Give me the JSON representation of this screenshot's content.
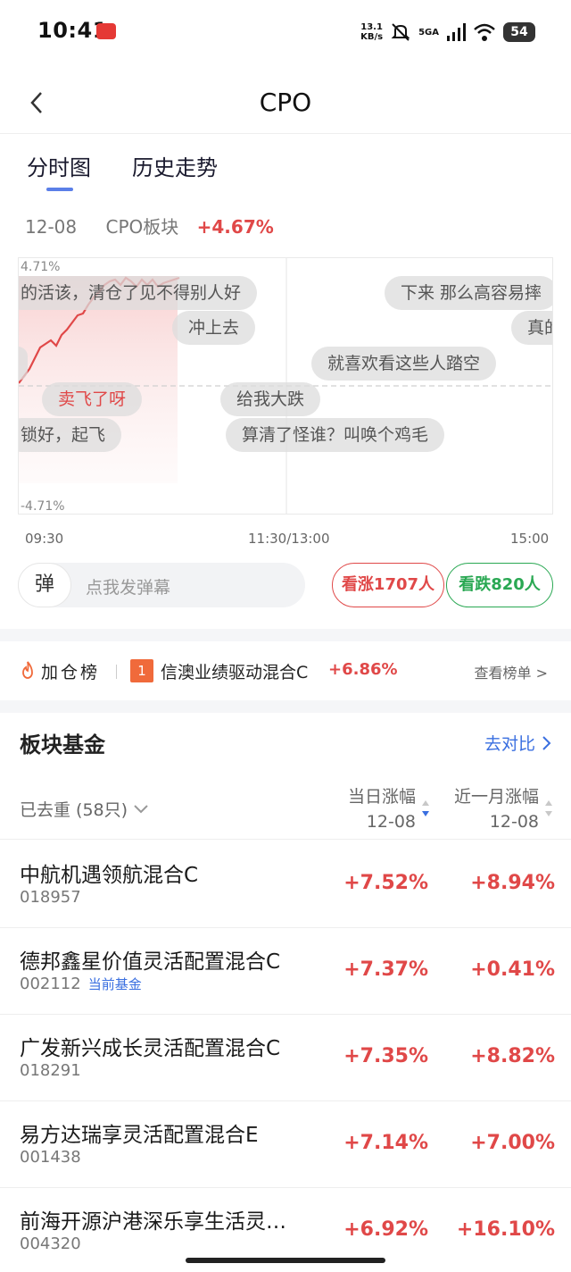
{
  "status_bar": {
    "time": "10:41",
    "net_speed_value": "13.1",
    "net_speed_unit": "KB/s",
    "network": "5GA",
    "battery": "54"
  },
  "nav": {
    "title": "CPO"
  },
  "tabs": [
    {
      "label": "分时图",
      "active": true
    },
    {
      "label": "历史走势",
      "active": false
    }
  ],
  "summary": {
    "date": "12-08",
    "sector": "CPO板块",
    "change": "+4.67%"
  },
  "chart": {
    "y_top": "4.71%",
    "y_bottom": "-4.71%",
    "x_labels": [
      "09:30",
      "11:30/13:00",
      "15:00"
    ],
    "danmu": [
      "的活该，清仓了见不得别人好",
      "下来 那么高容易摔",
      "冲上去",
      "真的",
      "就喜欢看这些人踏空",
      "卖飞了呀",
      "给我大跌",
      "锁好，起飞",
      "算清了怪谁？叫唤个鸡毛"
    ]
  },
  "danmu_bar": {
    "button": "弹",
    "placeholder": "点我发弹幕",
    "bullish": "看涨1707人",
    "bearish": "看跌820人"
  },
  "rank": {
    "title": "加仓榜",
    "rank_no": "1",
    "fund": "信澳业绩驱动混合C",
    "change": "+6.86%",
    "link": "查看榜单 >"
  },
  "section": {
    "title": "板块基金",
    "compare": "去对比"
  },
  "list_header": {
    "filter": "已去重 (58只)",
    "col_day_title": "当日涨幅",
    "col_day_date": "12-08",
    "col_month_title": "近一月涨幅",
    "col_month_date": "12-08"
  },
  "funds": [
    {
      "name": "中航机遇领航混合C",
      "code": "018957",
      "tag": "",
      "day": "+7.52%",
      "month": "+8.94%"
    },
    {
      "name": "德邦鑫星价值灵活配置混合C",
      "code": "002112",
      "tag": "当前基金",
      "day": "+7.37%",
      "month": "+0.41%"
    },
    {
      "name": "广发新兴成长灵活配置混合C",
      "code": "018291",
      "tag": "",
      "day": "+7.35%",
      "month": "+8.82%"
    },
    {
      "name": "易方达瑞享灵活配置混合E",
      "code": "001438",
      "tag": "",
      "day": "+7.14%",
      "month": "+7.00%"
    },
    {
      "name": "前海开源沪港深乐享生活灵…",
      "code": "004320",
      "tag": "",
      "day": "+6.92%",
      "month": "+16.10%"
    }
  ]
}
